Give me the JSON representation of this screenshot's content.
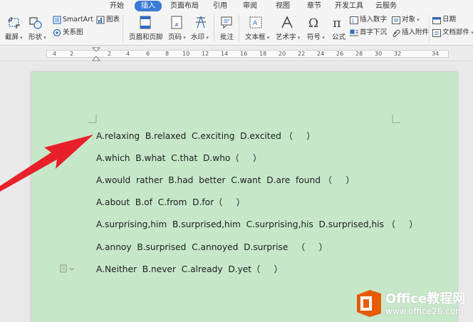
{
  "menu": {
    "tabs": [
      "开始",
      "插入",
      "页面布局",
      "引用",
      "审阅",
      "视图",
      "章节",
      "开发工具",
      "云服务"
    ],
    "active": "插入"
  },
  "ribbon": {
    "screenshot": "截屏",
    "shapes": "形状",
    "smartart": "SmartArt",
    "chart": "图表",
    "relation": "关系图",
    "header_footer": "页眉和页脚",
    "page_number": "页码",
    "watermark": "水印",
    "comment": "批注",
    "textbox": "文本框",
    "wordart": "艺术字",
    "symbol": "符号",
    "formula": "公式",
    "insert_number": "插入数字",
    "dropcap": "首字下沉",
    "object": "对象",
    "attachment": "插入附件",
    "date": "日期",
    "doc_parts": "文档部件"
  },
  "ruler": {
    "marks": [
      "4",
      "2",
      "2",
      "4",
      "6",
      "8",
      "10",
      "12",
      "14",
      "16",
      "18",
      "20",
      "22",
      "24",
      "26",
      "28",
      "30",
      "32",
      "34"
    ]
  },
  "document": {
    "lines": [
      "A.relaxing  B.relaxed  C.exciting  D.excited （     ）",
      "A.which  B.what  C.that  D.who（     ）",
      "A.would  rather  B.had  better  C.want  D.are  found （     ）",
      "A.about  B.of  C.from  D.for（     ）",
      "A.surprising,him  B.surprised,him  C.surprising,his  D.surprised,his （     ）",
      "A.annoy  B.surprised  C.annoyed  D.surprise   （     ）",
      "A.Neither  B.never  C.already  D.yet（     ）"
    ]
  },
  "watermark": {
    "brand": "Office教程网",
    "url": "www.office26.com"
  },
  "colors": {
    "page_bg": "#c6e8c9",
    "active_tab": "#3a7bd5",
    "arrow": "#e8202a",
    "logo_orange": "#e65c00"
  }
}
